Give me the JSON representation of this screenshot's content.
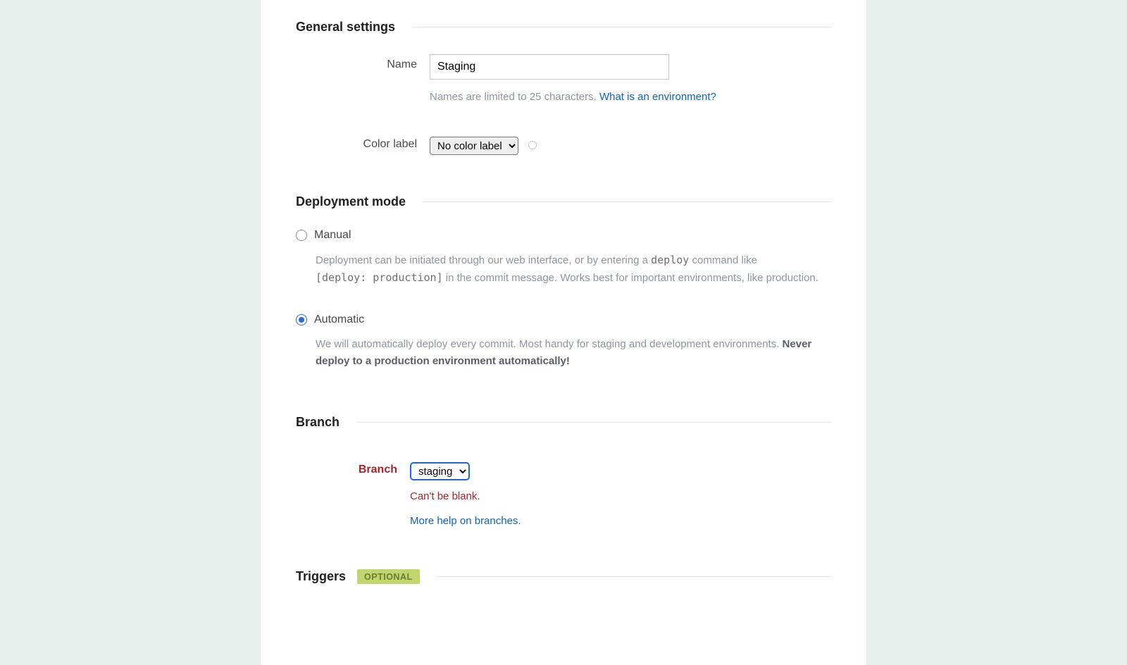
{
  "general": {
    "heading": "General settings",
    "name_label": "Name",
    "name_value": "Staging",
    "name_hint": "Names are limited to 25 characters.",
    "name_hint_link": "What is an environment?",
    "color_label": "Color label",
    "color_select_value": "No color label"
  },
  "deploy": {
    "heading": "Deployment mode",
    "manual": {
      "label": "Manual",
      "desc1": "Deployment can be initiated through our web interface, or by entering a ",
      "code": "deploy",
      "desc2": " command like",
      "code2": "[deploy: production]",
      "desc3": " in the commit message. Works best for important environments, like production.",
      "checked": false
    },
    "automatic": {
      "label": "Automatic",
      "desc1": "We will automatically deploy every commit. Most handy for staging and development environments. ",
      "strong": "Never deploy to a production environment automatically!",
      "checked": true
    }
  },
  "branch": {
    "heading": "Branch",
    "label": "Branch",
    "select_value": "staging",
    "error": "Can't be blank.",
    "help_link": "More help on branches."
  },
  "triggers": {
    "heading": "Triggers",
    "badge": "OPTIONAL"
  }
}
